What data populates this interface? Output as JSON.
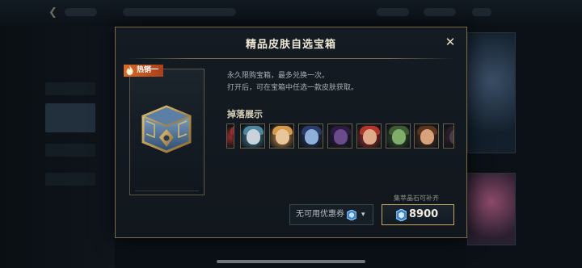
{
  "background": {
    "back_glyph": "❮",
    "right_card_colors": [
      "#3a4e66",
      "#8d4a6a"
    ]
  },
  "modal": {
    "title": "精品皮肤自选宝箱",
    "close_glyph": "✕",
    "hot_badge": "热销一",
    "chest_icon": "hextech-chest-icon",
    "description_lines": [
      "永久限购宝箱，最多兑换一次。",
      "打开后，可在宝箱中任选一款皮肤获取。"
    ],
    "drops_title": "掉落展示",
    "drop_thumbnails": [
      {
        "name": "drop-skin-partial",
        "skin": "#3c1518",
        "hair": "#8f2a2e"
      },
      {
        "name": "drop-skin-silver-robot",
        "skin": "#c9d3dc",
        "hair": "#4f87a0"
      },
      {
        "name": "drop-skin-blonde",
        "skin": "#e8c59a",
        "hair": "#d69a4a"
      },
      {
        "name": "drop-skin-yordle",
        "skin": "#8fb0d8",
        "hair": "#2b3c6a"
      },
      {
        "name": "drop-skin-dark-assassin",
        "skin": "#6b4c8a",
        "hair": "#2c1d40"
      },
      {
        "name": "drop-skin-red-hair",
        "skin": "#e0ab8a",
        "hair": "#b3352c"
      },
      {
        "name": "drop-skin-green-creature",
        "skin": "#7fae6a",
        "hair": "#3f5a34"
      },
      {
        "name": "drop-skin-warrior",
        "skin": "#d8a27c",
        "hair": "#5a3620"
      },
      {
        "name": "drop-skin-partial-right",
        "skin": "#4a3a42",
        "hair": "#2a1e26"
      }
    ],
    "coupon": {
      "label": "无可用优惠券",
      "icon": "gem-icon",
      "caret": "▾"
    },
    "gem_note": "集萃晶石可补齐",
    "price": {
      "currency_icon": "blue-essence-gem-icon",
      "amount": "8900"
    },
    "accent_gold": "#c7a862",
    "border_gold": "#7a6a45"
  }
}
